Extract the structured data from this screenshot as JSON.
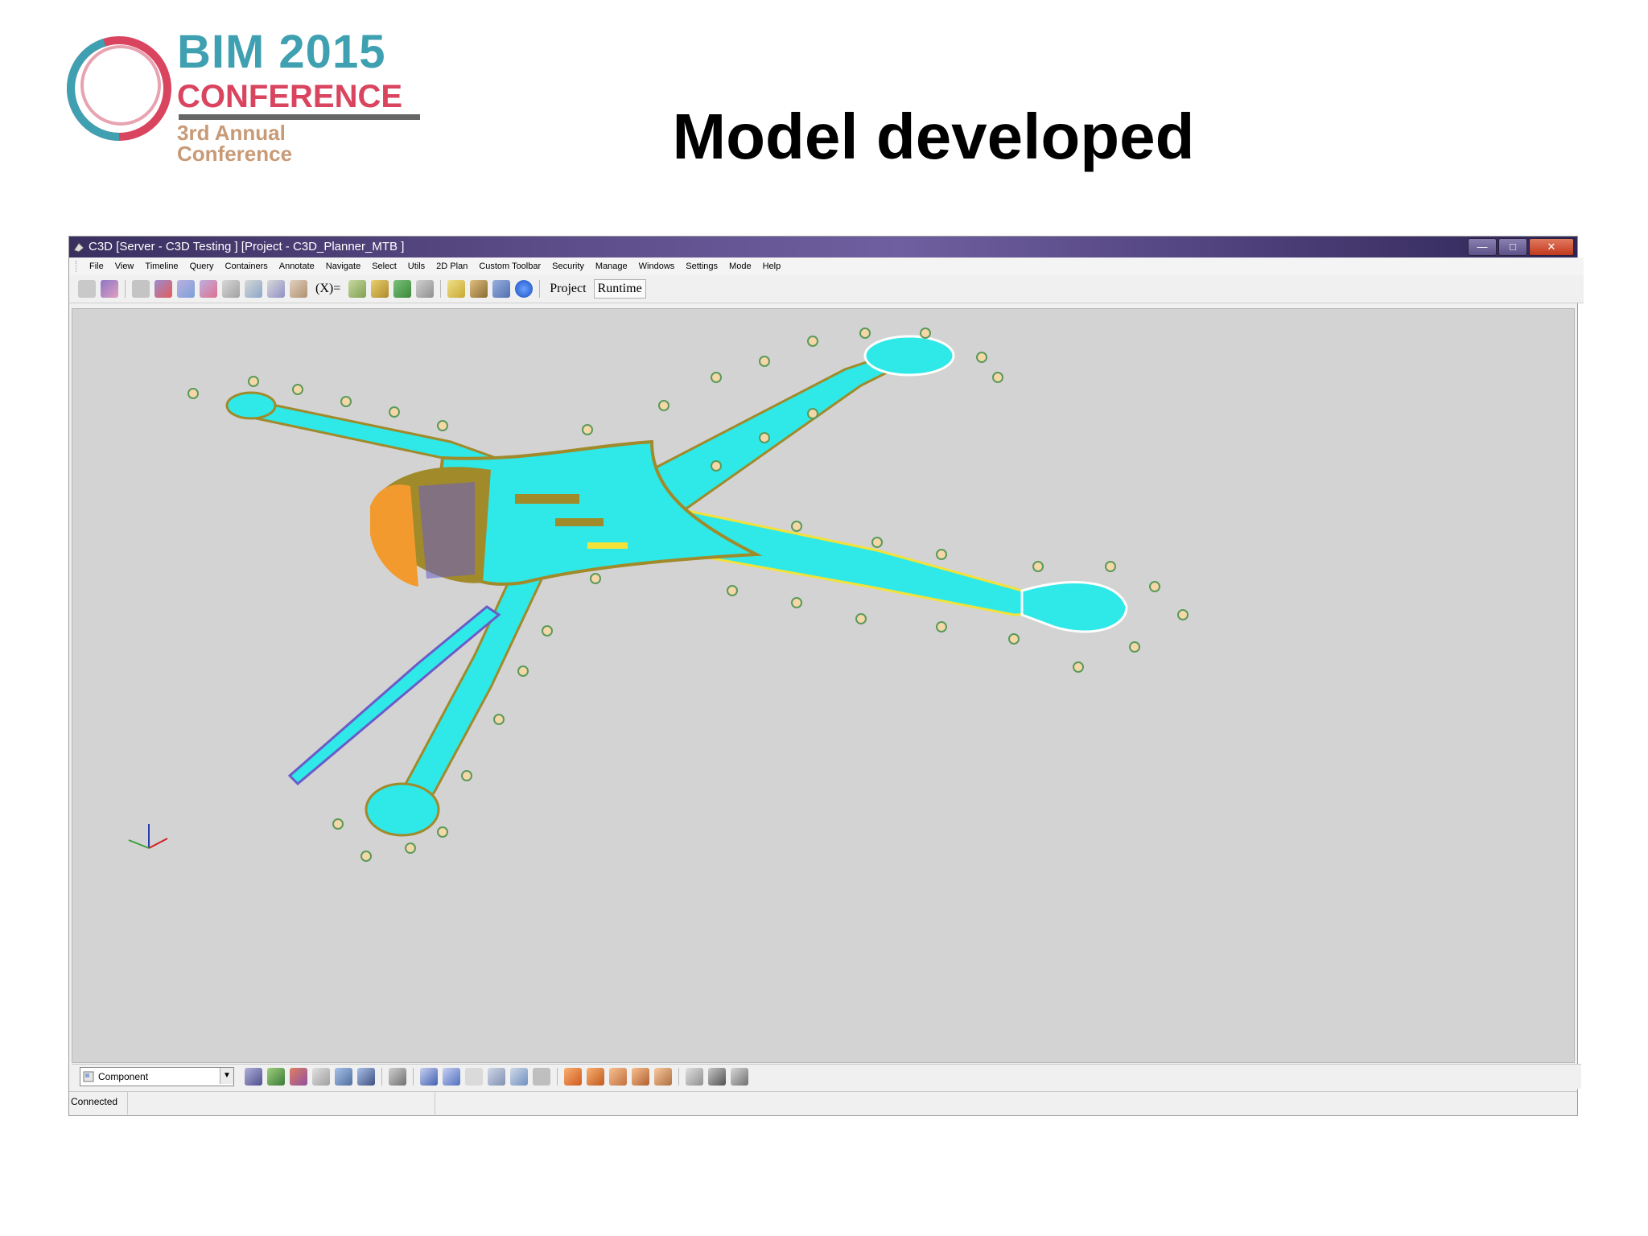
{
  "slide": {
    "title": "Model developed",
    "logo": {
      "year_line": "BIM 2015",
      "conference_line": "CONFERENCE",
      "subtitle_line": "3rd Annual Conference"
    }
  },
  "window": {
    "title": "C3D [Server - C3D Testing ] [Project - C3D_Planner_MTB ]",
    "controls": [
      "minimize",
      "maximize",
      "close"
    ]
  },
  "menu": [
    "File",
    "View",
    "Timeline",
    "Query",
    "Containers",
    "Annotate",
    "Navigate",
    "Select",
    "Utils",
    "2D Plan",
    "Custom Toolbar",
    "Security",
    "Manage",
    "Windows",
    "Settings",
    "Mode",
    "Help"
  ],
  "toolbar": {
    "project_label": "Project",
    "runtime_label": "Runtime",
    "formula_label": "(X)="
  },
  "viewport": {
    "content": "3D airport terminal model",
    "axis_icon": "xyz-axis-gizmo"
  },
  "bottom_toolbar": {
    "selection_mode": "Component"
  },
  "status": {
    "connection": "Connected"
  },
  "colors": {
    "model_cyan": "#2fe8e8",
    "model_olive": "#a08a2a",
    "model_orange": "#f29a2e",
    "model_purple": "#6a5cc8",
    "viewport_bg": "#d3d3d3"
  }
}
